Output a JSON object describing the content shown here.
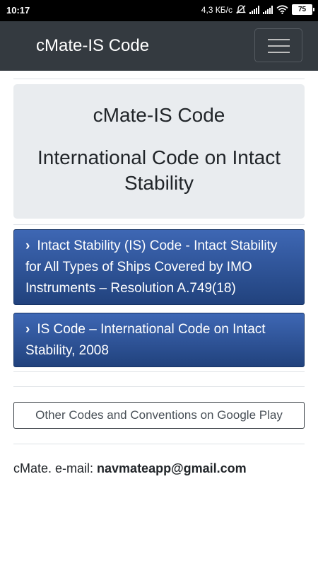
{
  "status_bar": {
    "time": "10:17",
    "speed": "4,3 КБ/с",
    "battery": "75",
    "icons": [
      "mute-icon",
      "signal-icon",
      "signal-icon",
      "wifi-icon",
      "battery-icon"
    ]
  },
  "navbar": {
    "brand": "cMate-IS Code",
    "menu_icon": "hamburger-menu-icon"
  },
  "jumbotron": {
    "title": "cMate-IS Code",
    "subtitle": "International Code on Intact Stability"
  },
  "sections": [
    {
      "chevron": "›",
      "label": "Intact Stability (IS) Code - Intact Stability for All Types of Ships Covered by IMO Instruments – Resolution A.749(18)"
    },
    {
      "chevron": "›",
      "label": "IS Code – International Code on Intact Stability, 2008"
    }
  ],
  "other_codes_button": "Other Codes and Conventions on Google Play",
  "footer": {
    "prefix": "cMate. e-mail: ",
    "email": "navmateapp@gmail.com"
  },
  "colors": {
    "navbar": "#343a40",
    "jumbotron": "#e9ecef",
    "section_button_top": "#3e67b4",
    "section_button_bottom": "#21427d"
  }
}
